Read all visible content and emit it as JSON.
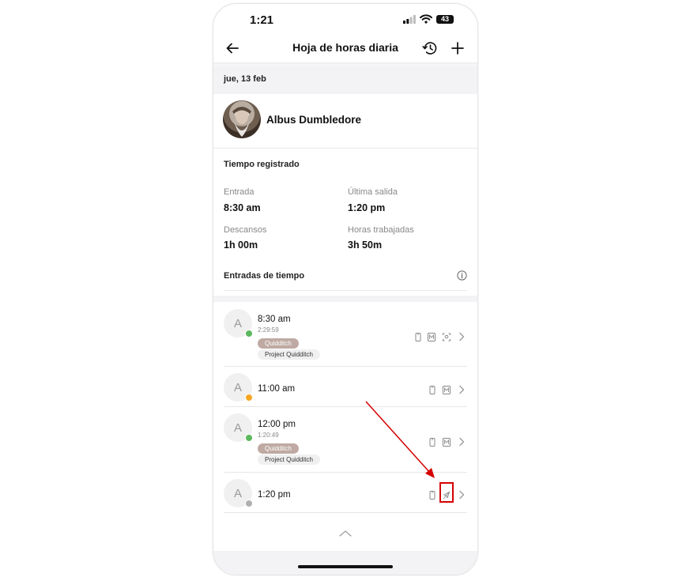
{
  "status_bar": {
    "time": "1:21",
    "battery": "43"
  },
  "header": {
    "title": "Hoja de horas diaria"
  },
  "date": "jue, 13 feb",
  "user": {
    "name": "Albus Dumbledore"
  },
  "tiempo_registrado": {
    "title": "Tiempo registrado",
    "stats": [
      {
        "label": "Entrada",
        "value": "8:30 am"
      },
      {
        "label": "Última salida",
        "value": "1:20 pm"
      },
      {
        "label": "Descansos",
        "value": "1h 00m"
      },
      {
        "label": "Horas trabajadas",
        "value": "3h 50m"
      }
    ]
  },
  "entradas": {
    "title": "Entradas de tiempo",
    "items": [
      {
        "avatar": "A",
        "status_color": "#5cb85c",
        "time": "8:30 am",
        "duration": "2:29:59",
        "tag": "Quidditch",
        "project": "Project Quidditch",
        "icons": [
          "phone-icon",
          "manual-icon",
          "face-scan-icon"
        ]
      },
      {
        "avatar": "A",
        "status_color": "#f5a623",
        "time": "11:00 am",
        "duration": "",
        "tag": "",
        "project": "",
        "icons": [
          "phone-icon",
          "manual-icon"
        ]
      },
      {
        "avatar": "A",
        "status_color": "#5cb85c",
        "time": "12:00 pm",
        "duration": "1:20:49",
        "tag": "Quidditch",
        "project": "Project Quidditch",
        "icons": [
          "phone-icon",
          "manual-icon"
        ]
      },
      {
        "avatar": "A",
        "status_color": "#b0b0b0",
        "time": "1:20 pm",
        "duration": "",
        "tag": "",
        "project": "",
        "icons": [
          "phone-icon",
          "no-location-icon"
        ]
      }
    ]
  },
  "annotation_color": "#d50000"
}
